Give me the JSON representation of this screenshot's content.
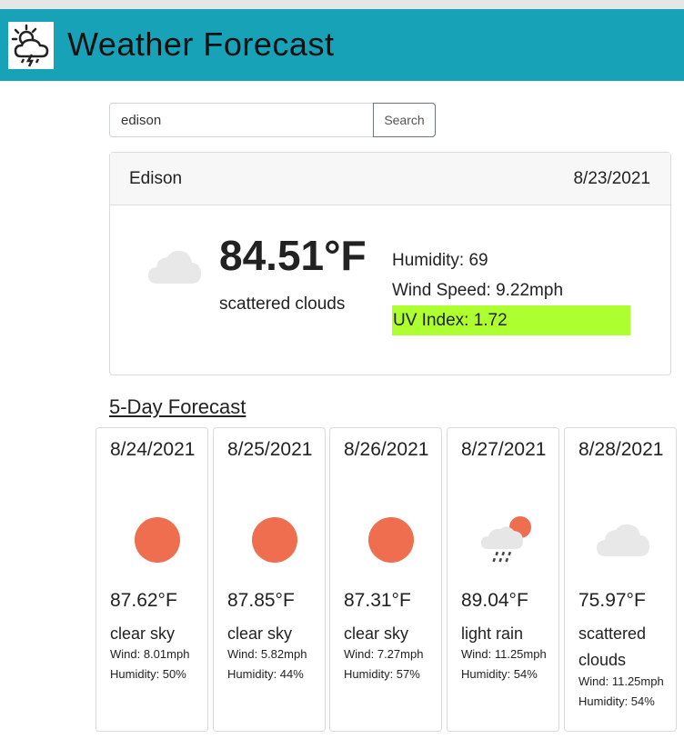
{
  "header": {
    "title": "Weather Forecast",
    "logo_icon": "thunderstorm-sun-icon"
  },
  "search": {
    "value": "edison",
    "button_label": "Search"
  },
  "current": {
    "city": "Edison",
    "date": "8/23/2021",
    "temp": "84.51°F",
    "description": "scattered clouds",
    "humidity": "Humidity: 69",
    "wind": "Wind Speed: 9.22mph",
    "uv": "UV Index: 1.72",
    "uv_color": "#adff2f",
    "icon": "cloud-icon"
  },
  "forecast": {
    "title": "5-Day Forecast",
    "days": [
      {
        "date": "8/24/2021",
        "icon": "sun-icon",
        "temp": "87.62°F",
        "description": "clear sky",
        "wind": "Wind: 8.01mph",
        "humidity": "Humidity: 50%"
      },
      {
        "date": "8/25/2021",
        "icon": "sun-icon",
        "temp": "87.85°F",
        "description": "clear sky",
        "wind": "Wind: 5.82mph",
        "humidity": "Humidity: 44%"
      },
      {
        "date": "8/26/2021",
        "icon": "sun-icon",
        "temp": "87.31°F",
        "description": "clear sky",
        "wind": "Wind: 7.27mph",
        "humidity": "Humidity: 57%"
      },
      {
        "date": "8/27/2021",
        "icon": "rain-cloud-sun-icon",
        "temp": "89.04°F",
        "description": "light rain",
        "wind": "Wind: 11.25mph",
        "humidity": "Humidity: 54%"
      },
      {
        "date": "8/28/2021",
        "icon": "cloud-icon",
        "temp": "75.97°F",
        "description": "scattered clouds",
        "wind": "Wind: 11.25mph",
        "humidity": "Humidity: 54%"
      }
    ]
  },
  "colors": {
    "header_bg": "#17a2b8",
    "sun": "#ee6e4f",
    "cloud": "#e5e5e5"
  }
}
